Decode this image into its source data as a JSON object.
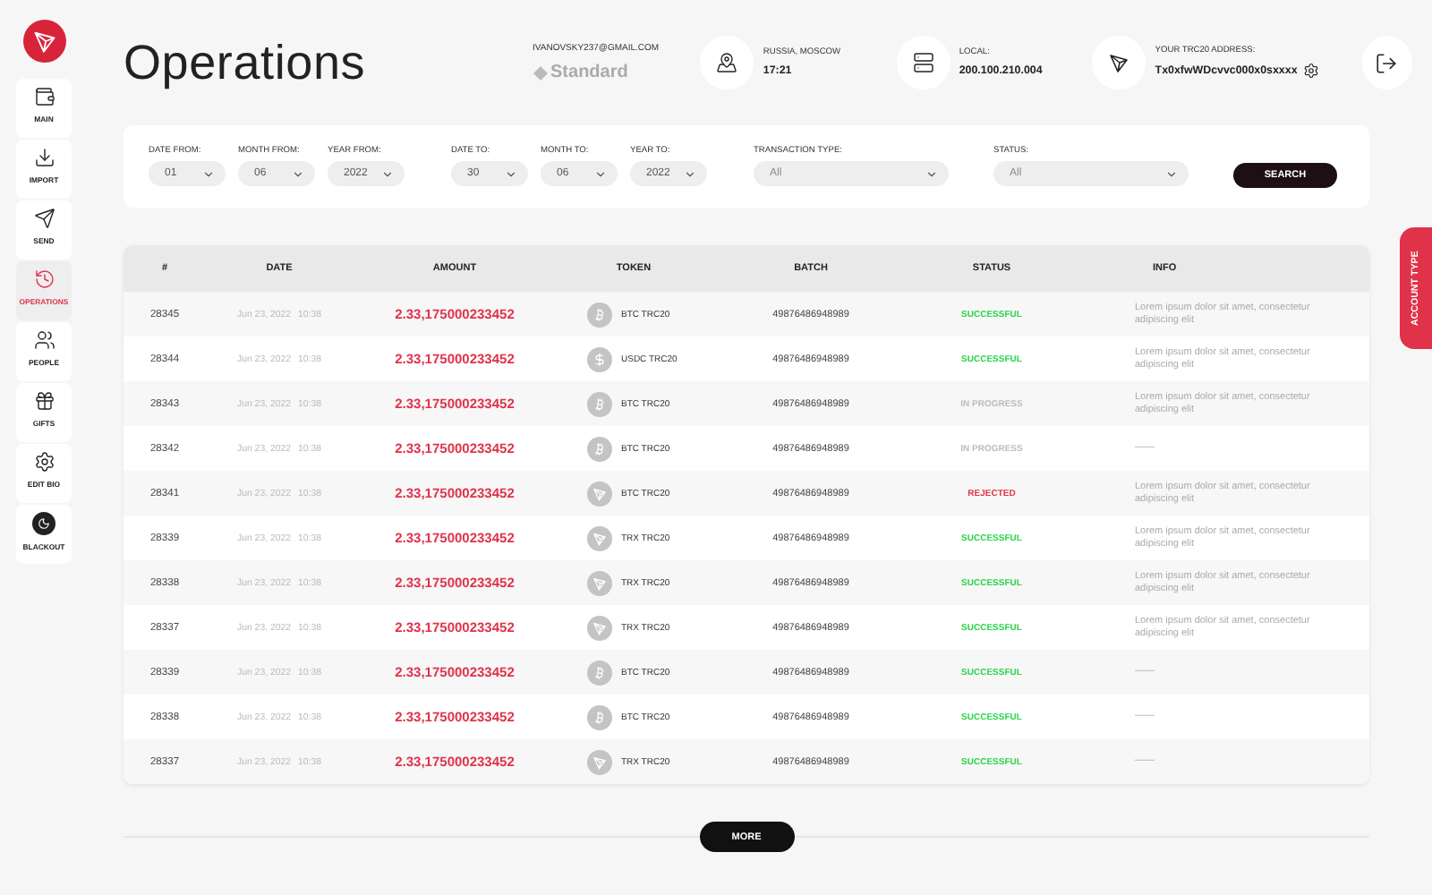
{
  "sidebar": {
    "items": [
      {
        "kind": "main",
        "label": "MAIN",
        "selected": false
      },
      {
        "kind": "import",
        "label": "IMPORT",
        "selected": false
      },
      {
        "kind": "send",
        "label": "SEND",
        "selected": false
      },
      {
        "kind": "operations",
        "label": "OPERATIONS",
        "selected": true
      },
      {
        "kind": "people",
        "label": "PEOPLE",
        "selected": false
      },
      {
        "kind": "gifts",
        "label": "GIFTS",
        "selected": false
      },
      {
        "kind": "settings",
        "label": "EDIT BIO",
        "selected": false
      },
      {
        "kind": "dark",
        "label": "BLACKOUT",
        "selected": false
      }
    ]
  },
  "header": {
    "title": "Operations",
    "account": {
      "email": "IVANOVSKY237@GMAIL.COM",
      "plan": "Standard"
    },
    "info": [
      {
        "kind": "location",
        "label": "RUSSIA, MOSCOW",
        "value": "17:21"
      },
      {
        "kind": "server",
        "label": "LOCAL:",
        "value": "200.100.210.004"
      },
      {
        "kind": "address",
        "label": "YOUR TRC20 ADDRESS:",
        "value": "Tx0xfwWDcvvc000x0sxxxx"
      }
    ]
  },
  "filters": {
    "from": [
      {
        "label": "DATE FROM:",
        "value": "01"
      },
      {
        "label": "MONTH FROM:",
        "value": "06"
      },
      {
        "label": "YEAR FROM:",
        "value": "2022"
      }
    ],
    "to": [
      {
        "label": "DATE TO:",
        "value": "30"
      },
      {
        "label": "MONTH TO:",
        "value": "06"
      },
      {
        "label": "YEAR TO:",
        "value": "2022"
      }
    ],
    "selects": [
      {
        "label": "TRANSACTION TYPE:",
        "value": "All"
      },
      {
        "label": "STATUS:",
        "value": "All"
      }
    ],
    "button": "SEARCH"
  },
  "table": {
    "columns": [
      "#",
      "DATE",
      "AMOUNT",
      "TOKEN",
      "BATCH",
      "STATUS",
      "INFO"
    ],
    "rows": [
      {
        "number": "28345",
        "date": "Jun 23, 2022",
        "time": "10:38",
        "amount": "2.33,175000233452",
        "token": {
          "kind": "btc",
          "label": "BTC TRC20"
        },
        "batch": "49876486948989",
        "status": {
          "kind": "successful",
          "label": "SUCCESSFUL"
        },
        "info": "Lorem ipsum dolor sit amet, consectetur adipiscing elit"
      },
      {
        "number": "28344",
        "date": "Jun 23, 2022",
        "time": "10:38",
        "amount": "2.33,175000233452",
        "token": {
          "kind": "usdc",
          "label": "USDC TRC20"
        },
        "batch": "49876486948989",
        "status": {
          "kind": "successful",
          "label": "SUCCESSFUL"
        },
        "info": "Lorem ipsum dolor sit amet, consectetur adipiscing elit"
      },
      {
        "number": "28343",
        "date": "Jun 23, 2022",
        "time": "10:38",
        "amount": "2.33,175000233452",
        "token": {
          "kind": "btc",
          "label": "BTC TRC20"
        },
        "batch": "49876486948989",
        "status": {
          "kind": "in_progress",
          "label": "IN PROGRESS"
        },
        "info": "Lorem ipsum dolor sit amet, consectetur adipiscing elit"
      },
      {
        "number": "28342",
        "date": "Jun 23, 2022",
        "time": "10:38",
        "amount": "2.33,175000233452",
        "token": {
          "kind": "btc",
          "label": "BTC TRC20"
        },
        "batch": "49876486948989",
        "status": {
          "kind": "in_progress",
          "label": "IN PROGRESS"
        },
        "info": "——"
      },
      {
        "number": "28341",
        "date": "Jun 23, 2022",
        "time": "10:38",
        "amount": "2.33,175000233452",
        "token": {
          "kind": "trx",
          "label": "BTC TRC20"
        },
        "batch": "49876486948989",
        "status": {
          "kind": "rejected",
          "label": "REJECTED"
        },
        "info": "Lorem ipsum dolor sit amet, consectetur adipiscing elit"
      },
      {
        "number": "28339",
        "date": "Jun 23, 2022",
        "time": "10:38",
        "amount": "2.33,175000233452",
        "token": {
          "kind": "trx",
          "label": "TRX TRC20"
        },
        "batch": "49876486948989",
        "status": {
          "kind": "successful",
          "label": "SUCCESSFUL"
        },
        "info": "Lorem ipsum dolor sit amet, consectetur adipiscing elit"
      },
      {
        "number": "28338",
        "date": "Jun 23, 2022",
        "time": "10:38",
        "amount": "2.33,175000233452",
        "token": {
          "kind": "trx",
          "label": "TRX TRC20"
        },
        "batch": "49876486948989",
        "status": {
          "kind": "successful",
          "label": "SUCCESSFUL"
        },
        "info": "Lorem ipsum dolor sit amet, consectetur adipiscing elit"
      },
      {
        "number": "28337",
        "date": "Jun 23, 2022",
        "time": "10:38",
        "amount": "2.33,175000233452",
        "token": {
          "kind": "trx",
          "label": "TRX TRC20"
        },
        "batch": "49876486948989",
        "status": {
          "kind": "successful",
          "label": "SUCCESSFUL"
        },
        "info": "Lorem ipsum dolor sit amet, consectetur adipiscing elit"
      },
      {
        "number": "28339",
        "date": "Jun 23, 2022",
        "time": "10:38",
        "amount": "2.33,175000233452",
        "token": {
          "kind": "btc",
          "label": "BTC TRC20"
        },
        "batch": "49876486948989",
        "status": {
          "kind": "successful",
          "label": "SUCCESSFUL"
        },
        "info": "——"
      },
      {
        "number": "28338",
        "date": "Jun 23, 2022",
        "time": "10:38",
        "amount": "2.33,175000233452",
        "token": {
          "kind": "btc",
          "label": "BTC TRC20"
        },
        "batch": "49876486948989",
        "status": {
          "kind": "successful",
          "label": "SUCCESSFUL"
        },
        "info": "——"
      },
      {
        "number": "28337",
        "date": "Jun 23, 2022",
        "time": "10:38",
        "amount": "2.33,175000233452",
        "token": {
          "kind": "trx",
          "label": "TRX TRC20"
        },
        "batch": "49876486948989",
        "status": {
          "kind": "successful",
          "label": "SUCCESSFUL"
        },
        "info": "——"
      }
    ]
  },
  "more_button": "MORE",
  "account_tab": "ACCOUNT TYPE"
}
